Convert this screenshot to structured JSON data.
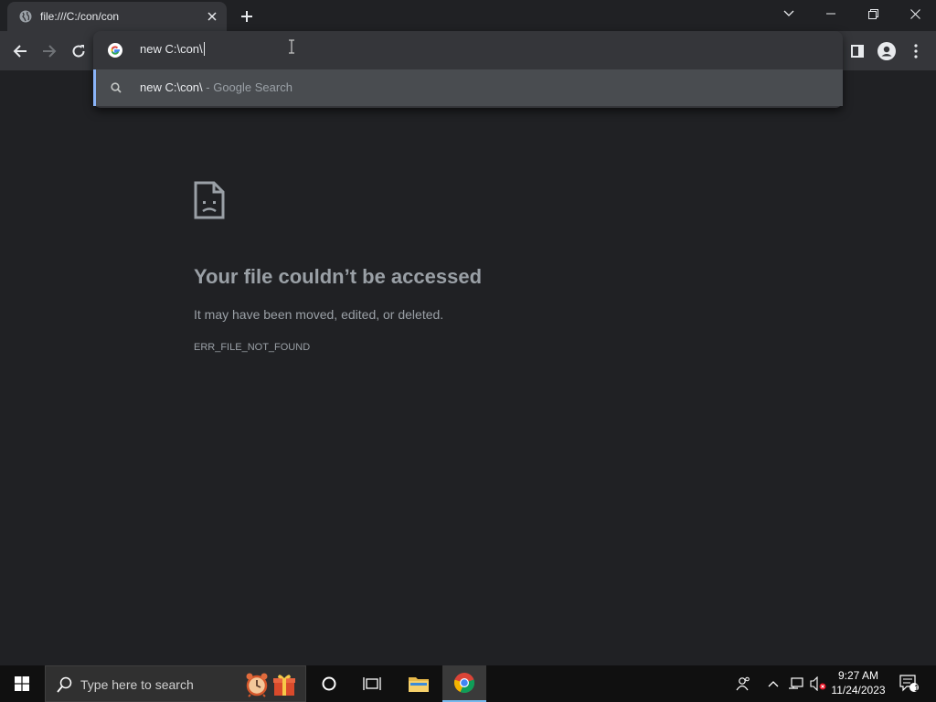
{
  "tab": {
    "title": "file:///C:/con/con"
  },
  "omnibox": {
    "input_value": "new C:\\con\\",
    "suggestion": {
      "query": "new C:\\con\\",
      "provider": " - Google Search"
    }
  },
  "error_page": {
    "title": "Your file couldn’t be accessed",
    "message": "It may have been moved, edited, or deleted.",
    "code": "ERR_FILE_NOT_FOUND"
  },
  "taskbar": {
    "search_placeholder": "Type here to search",
    "time": "9:27 AM",
    "date": "11/24/2023",
    "notification_count": "1"
  },
  "colors": {
    "accent": "#8ab4f8",
    "background": "#202124",
    "toolbar": "#35363a"
  }
}
